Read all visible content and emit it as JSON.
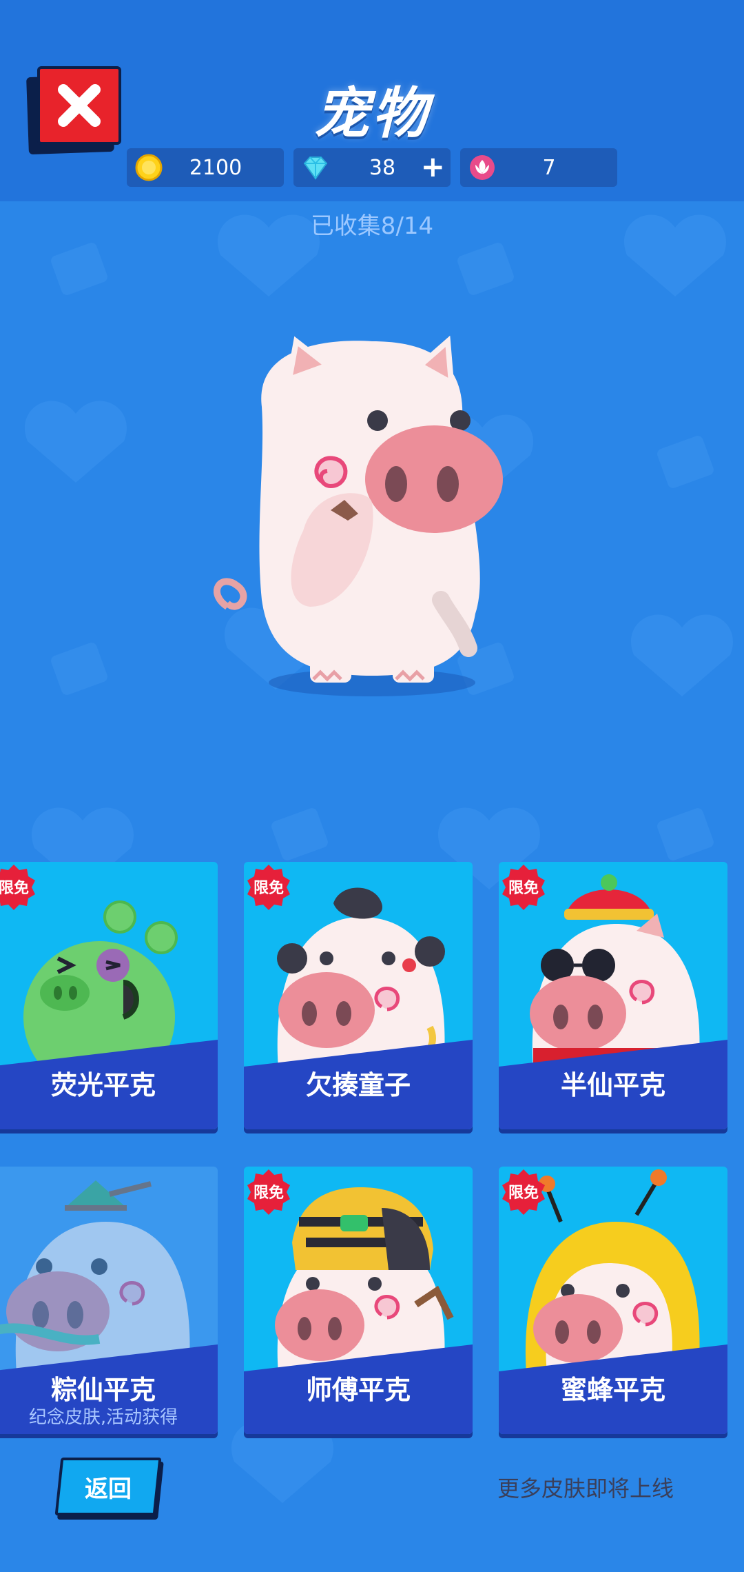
{
  "header": {
    "title": "宠物",
    "currencies": [
      {
        "icon": "coin-icon",
        "value": "2100"
      },
      {
        "icon": "diamond-icon",
        "value": "38",
        "add": "+"
      },
      {
        "icon": "flower-token-icon",
        "value": "7"
      }
    ]
  },
  "collection": {
    "label": "已收集8/14"
  },
  "skins": [
    {
      "name": "荧光平克",
      "badge": "限免"
    },
    {
      "name": "欠揍童子",
      "badge": "限免"
    },
    {
      "name": "半仙平克",
      "badge": "限免"
    },
    {
      "name": "粽仙平克",
      "subtitle": "纪念皮肤,活动获得"
    },
    {
      "name": "师傅平克",
      "badge": "限免"
    },
    {
      "name": "蜜蜂平克",
      "badge": "限免"
    }
  ],
  "footer": {
    "back_label": "返回",
    "more_text": "更多皮肤即将上线"
  },
  "colors": {
    "background": "#2a86e8",
    "header": "#2274dc",
    "card": "#0fb8f3",
    "card_band": "#2546c4",
    "close_button": "#e8232b",
    "badge": "#e6203a"
  }
}
